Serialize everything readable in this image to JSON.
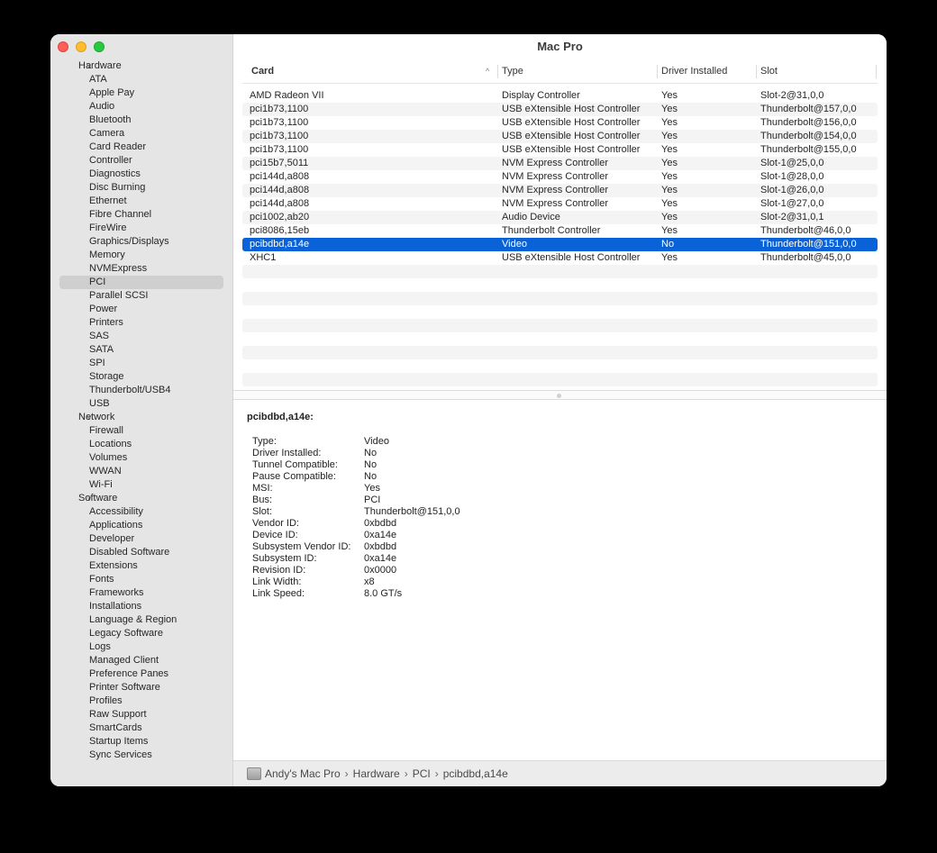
{
  "window_title": "Mac Pro",
  "sidebar": {
    "groups": [
      {
        "label": "Hardware",
        "items": [
          "ATA",
          "Apple Pay",
          "Audio",
          "Bluetooth",
          "Camera",
          "Card Reader",
          "Controller",
          "Diagnostics",
          "Disc Burning",
          "Ethernet",
          "Fibre Channel",
          "FireWire",
          "Graphics/Displays",
          "Memory",
          "NVMExpress",
          "PCI",
          "Parallel SCSI",
          "Power",
          "Printers",
          "SAS",
          "SATA",
          "SPI",
          "Storage",
          "Thunderbolt/USB4",
          "USB"
        ]
      },
      {
        "label": "Network",
        "items": [
          "Firewall",
          "Locations",
          "Volumes",
          "WWAN",
          "Wi-Fi"
        ]
      },
      {
        "label": "Software",
        "items": [
          "Accessibility",
          "Applications",
          "Developer",
          "Disabled Software",
          "Extensions",
          "Fonts",
          "Frameworks",
          "Installations",
          "Language & Region",
          "Legacy Software",
          "Logs",
          "Managed Client",
          "Preference Panes",
          "Printer Software",
          "Profiles",
          "Raw Support",
          "SmartCards",
          "Startup Items",
          "Sync Services"
        ]
      }
    ],
    "selected": "PCI"
  },
  "table": {
    "headers": {
      "card": "Card",
      "type": "Type",
      "driver": "Driver Installed",
      "slot": "Slot"
    },
    "rows": [
      {
        "card": "AMD Radeon VII",
        "type": "Display Controller",
        "driver": "Yes",
        "slot": "Slot-2@31,0,0"
      },
      {
        "card": "pci1b73,1100",
        "type": "USB eXtensible Host Controller",
        "driver": "Yes",
        "slot": "Thunderbolt@157,0,0"
      },
      {
        "card": "pci1b73,1100",
        "type": "USB eXtensible Host Controller",
        "driver": "Yes",
        "slot": "Thunderbolt@156,0,0"
      },
      {
        "card": "pci1b73,1100",
        "type": "USB eXtensible Host Controller",
        "driver": "Yes",
        "slot": "Thunderbolt@154,0,0"
      },
      {
        "card": "pci1b73,1100",
        "type": "USB eXtensible Host Controller",
        "driver": "Yes",
        "slot": "Thunderbolt@155,0,0"
      },
      {
        "card": "pci15b7,5011",
        "type": "NVM Express Controller",
        "driver": "Yes",
        "slot": "Slot-1@25,0,0"
      },
      {
        "card": "pci144d,a808",
        "type": "NVM Express Controller",
        "driver": "Yes",
        "slot": "Slot-1@28,0,0"
      },
      {
        "card": "pci144d,a808",
        "type": "NVM Express Controller",
        "driver": "Yes",
        "slot": "Slot-1@26,0,0"
      },
      {
        "card": "pci144d,a808",
        "type": "NVM Express Controller",
        "driver": "Yes",
        "slot": "Slot-1@27,0,0"
      },
      {
        "card": "pci1002,ab20",
        "type": "Audio Device",
        "driver": "Yes",
        "slot": "Slot-2@31,0,1"
      },
      {
        "card": "pci8086,15eb",
        "type": "Thunderbolt Controller",
        "driver": "Yes",
        "slot": "Thunderbolt@46,0,0"
      },
      {
        "card": "pcibdbd,a14e",
        "type": "Video",
        "driver": "No",
        "slot": "Thunderbolt@151,0,0"
      },
      {
        "card": "XHC1",
        "type": "USB eXtensible Host Controller",
        "driver": "Yes",
        "slot": "Thunderbolt@45,0,0"
      }
    ],
    "selected_index": 11,
    "total_striped_rows": 22
  },
  "detail": {
    "title": "pcibdbd,a14e:",
    "properties": [
      {
        "k": "Type:",
        "v": "Video"
      },
      {
        "k": "Driver Installed:",
        "v": "No"
      },
      {
        "k": "Tunnel Compatible:",
        "v": "No"
      },
      {
        "k": "Pause Compatible:",
        "v": "No"
      },
      {
        "k": "MSI:",
        "v": "Yes"
      },
      {
        "k": "Bus:",
        "v": "PCI"
      },
      {
        "k": "Slot:",
        "v": "Thunderbolt@151,0,0"
      },
      {
        "k": "Vendor ID:",
        "v": "0xbdbd"
      },
      {
        "k": "Device ID:",
        "v": "0xa14e"
      },
      {
        "k": "Subsystem Vendor ID:",
        "v": "0xbdbd"
      },
      {
        "k": "Subsystem ID:",
        "v": "0xa14e"
      },
      {
        "k": "Revision ID:",
        "v": "0x0000"
      },
      {
        "k": "Link Width:",
        "v": "x8"
      },
      {
        "k": "Link Speed:",
        "v": "8.0 GT/s"
      }
    ]
  },
  "pathbar": {
    "crumbs": [
      "Andy's Mac Pro",
      "Hardware",
      "PCI",
      "pcibdbd,a14e"
    ],
    "separator": "›"
  }
}
